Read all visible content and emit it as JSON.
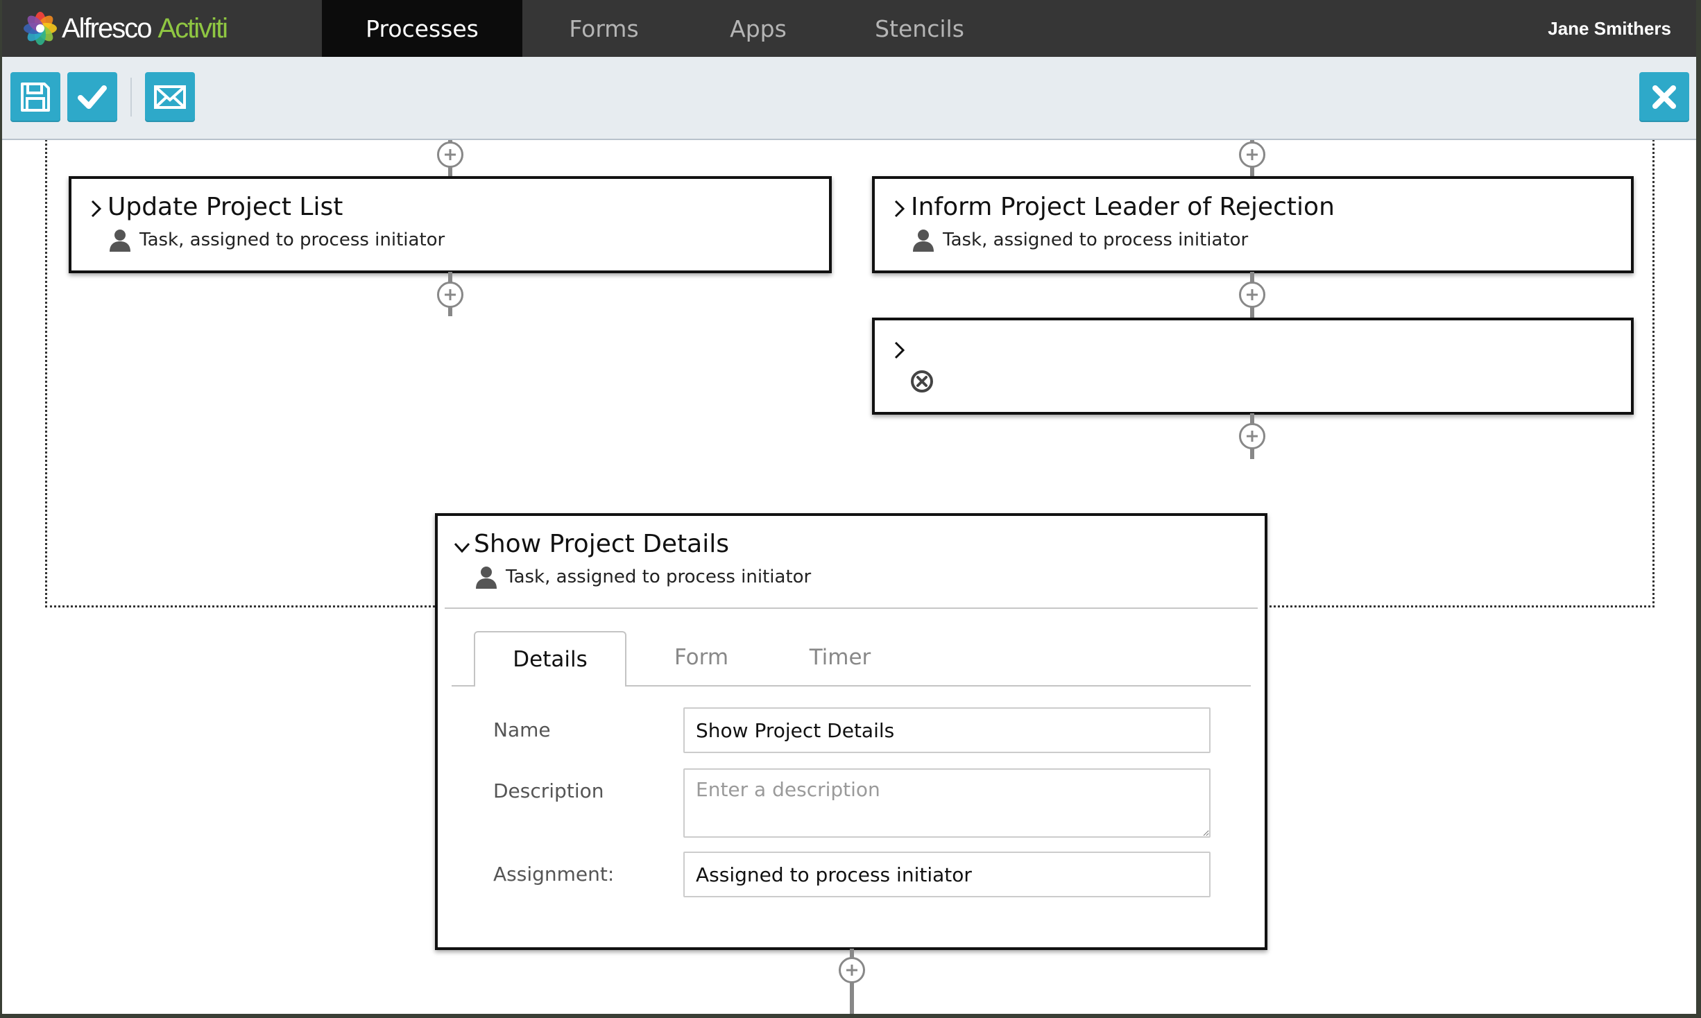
{
  "app": {
    "brand_primary": "Alfresco",
    "brand_secondary": "Activiti",
    "user": "Jane Smithers"
  },
  "nav": {
    "tabs": [
      {
        "label": "Processes",
        "active": true
      },
      {
        "label": "Forms",
        "active": false
      },
      {
        "label": "Apps",
        "active": false
      },
      {
        "label": "Stencils",
        "active": false
      }
    ]
  },
  "toolbar": {
    "buttons": [
      {
        "name": "save",
        "icon": "floppy-disk-icon"
      },
      {
        "name": "validate",
        "icon": "checkmark-icon"
      },
      {
        "name": "share",
        "icon": "envelope-icon"
      },
      {
        "name": "close",
        "icon": "close-icon"
      }
    ],
    "accent_color": "#2ea9c9"
  },
  "steps": {
    "update_project_list": {
      "title": "Update Project List",
      "subtitle": "Task, assigned to process initiator"
    },
    "inform_leader": {
      "title": "Inform Project Leader of Rejection",
      "subtitle": "Task, assigned to process initiator"
    },
    "empty_step": {
      "title": "",
      "icon": "cancel-circle-icon"
    },
    "show_project_details": {
      "title": "Show Project Details",
      "subtitle": "Task, assigned to process initiator",
      "expanded": true,
      "tabs": [
        {
          "label": "Details",
          "active": true
        },
        {
          "label": "Form",
          "active": false
        },
        {
          "label": "Timer",
          "active": false
        }
      ],
      "fields": {
        "name_label": "Name",
        "name_value": "Show Project Details",
        "description_label": "Description",
        "description_placeholder": "Enter a description",
        "assignment_label": "Assignment:",
        "assignment_value": "Assigned to process initiator"
      }
    }
  }
}
